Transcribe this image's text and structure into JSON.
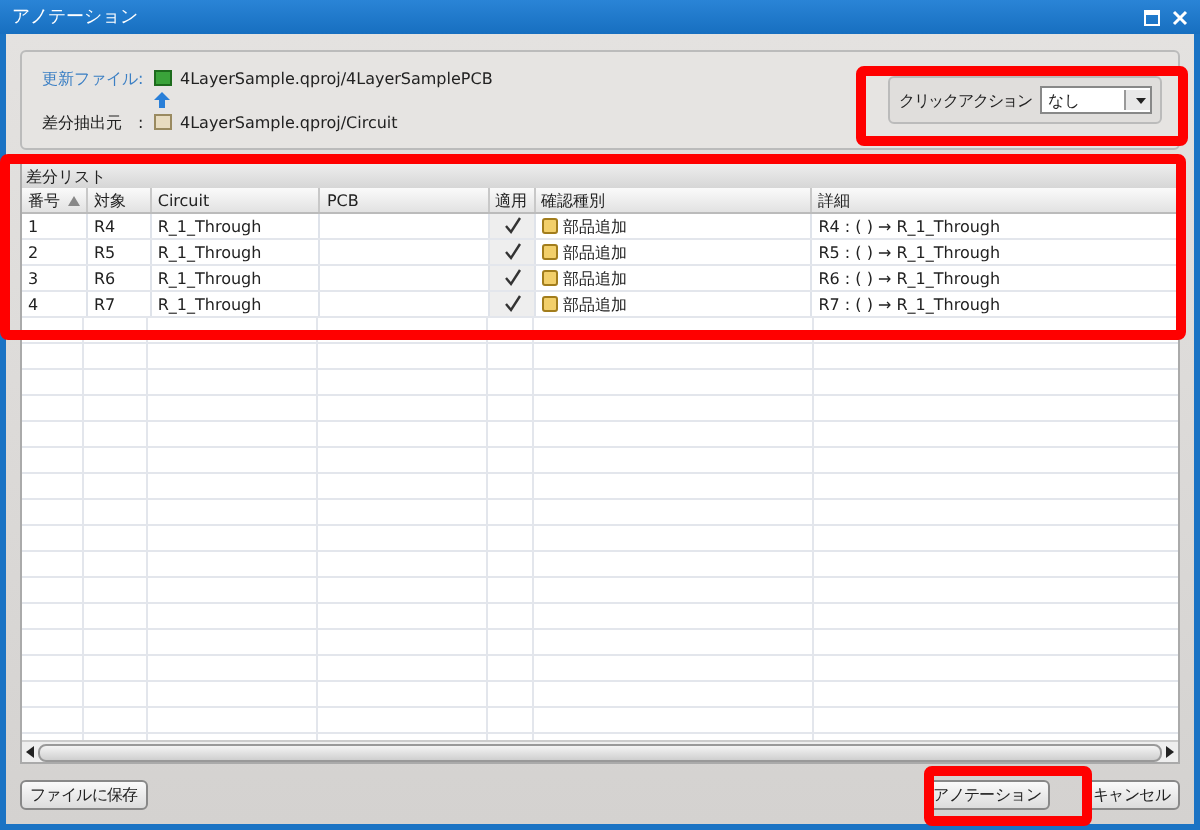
{
  "window": {
    "title": "アノテーション"
  },
  "files": {
    "update_label": "更新ファイル:",
    "update_path": "4LayerSample.qproj/4LayerSamplePCB",
    "source_label": "差分抽出元　:",
    "source_path": "4LayerSample.qproj/Circuit"
  },
  "click_action": {
    "label": "クリックアクション",
    "value": "なし"
  },
  "diff_list": {
    "title": "差分リスト",
    "columns": [
      "番号",
      "対象",
      "Circuit",
      "PCB",
      "適用",
      "確認種別",
      "詳細"
    ],
    "rows": [
      {
        "no": "1",
        "target": "R4",
        "circuit": "R_1_Through",
        "applied": true,
        "kind": "部品追加",
        "detail": "R4 : (  ) → R_1_Through"
      },
      {
        "no": "2",
        "target": "R5",
        "circuit": "R_1_Through",
        "applied": true,
        "kind": "部品追加",
        "detail": "R5 : (  ) → R_1_Through"
      },
      {
        "no": "3",
        "target": "R6",
        "circuit": "R_1_Through",
        "applied": true,
        "kind": "部品追加",
        "detail": "R6 : (  ) → R_1_Through"
      },
      {
        "no": "4",
        "target": "R7",
        "circuit": "R_1_Through",
        "applied": true,
        "kind": "部品追加",
        "detail": "R7 : (  ) → R_1_Through"
      }
    ]
  },
  "buttons": {
    "save": "ファイルに保存",
    "annotate": "アノテーション",
    "cancel": "キャンセル"
  }
}
